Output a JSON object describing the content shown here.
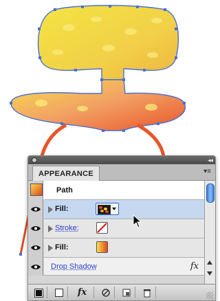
{
  "panel": {
    "tab_label": "APPEARANCE",
    "collapse_glyph": "◂◂",
    "menu_glyph": "▾≡",
    "object_label": "Path"
  },
  "rows": {
    "fill1": {
      "label": "Fill:"
    },
    "stroke": {
      "label": "Stroke:"
    },
    "fill2": {
      "label": "Fill:"
    },
    "effect": {
      "label": "Drop Shadow"
    }
  },
  "toolbar": {
    "fx_label": "fx",
    "icons": [
      "clear-appearance-icon",
      "add-stroke-icon",
      "add-effect-icon",
      "clear-icon",
      "duplicate-item-icon",
      "delete-item-icon"
    ]
  },
  "colors": {
    "selected_row": "#c6d8ef",
    "link": "#2a40c8",
    "fill_gradient_start": "#f9e04c",
    "fill_gradient_end": "#e04a1c",
    "selection_path": "#4a6fd6"
  }
}
